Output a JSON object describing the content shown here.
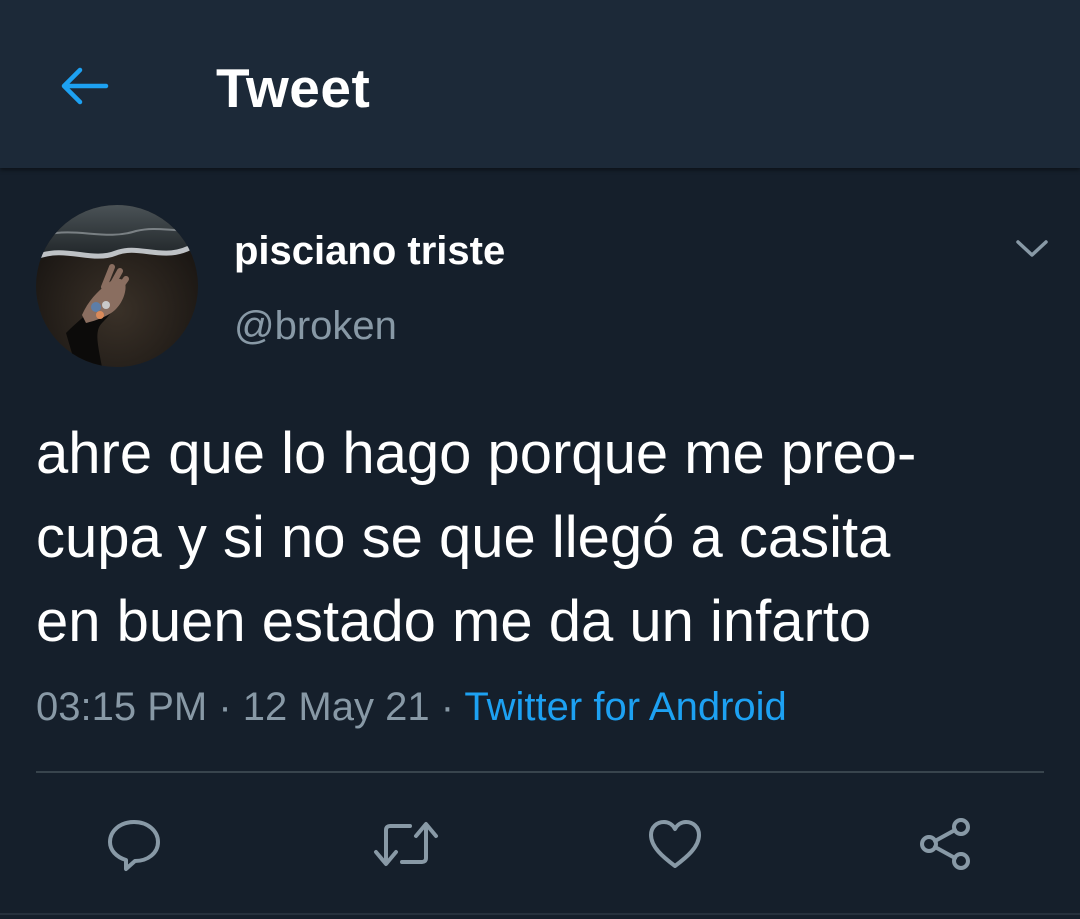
{
  "header": {
    "title": "Tweet",
    "back_icon": "arrow-left-icon"
  },
  "colors": {
    "background": "#151f2b",
    "header_background": "#1c2938",
    "accent": "#1da1f2",
    "secondary_text": "#8899a6",
    "divider": "#38444d"
  },
  "tweet": {
    "author": {
      "display_name": "pisciano triste",
      "handle": "@broken"
    },
    "text_lines": [
      "ahre que lo hago porque me preo-",
      "cupa y si no se que llegó a casita",
      "en buen estado me da un infarto"
    ],
    "time": "03:15 PM",
    "separator": "·",
    "date": "12 May 21",
    "source": "Twitter for Android"
  },
  "actions": [
    {
      "name": "reply",
      "icon": "reply-icon"
    },
    {
      "name": "retweet",
      "icon": "retweet-icon"
    },
    {
      "name": "like",
      "icon": "heart-icon"
    },
    {
      "name": "share",
      "icon": "share-icon"
    }
  ]
}
